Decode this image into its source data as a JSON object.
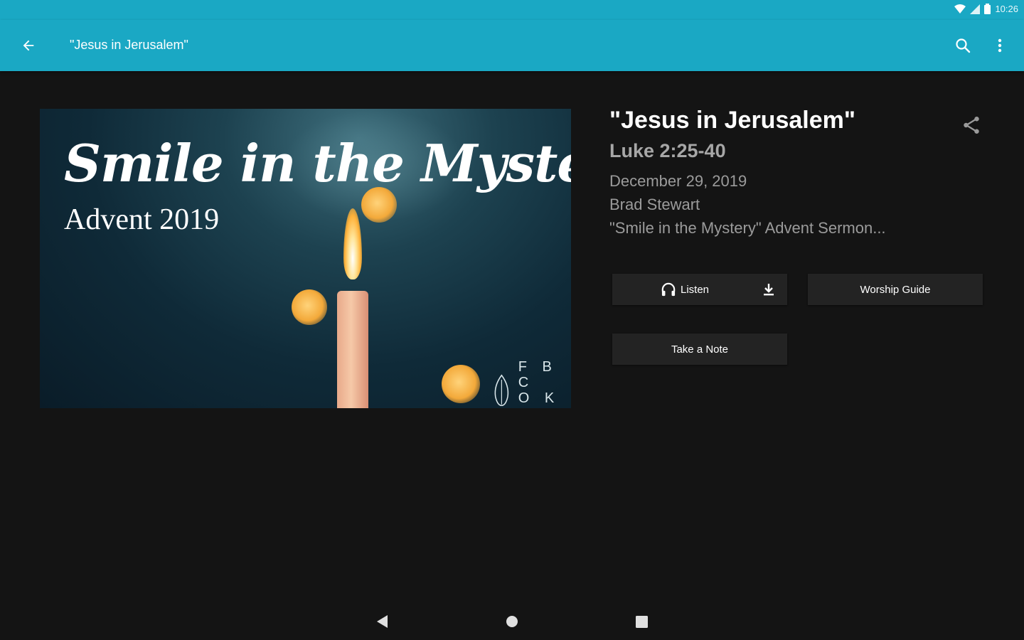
{
  "status_bar": {
    "time": "10:26",
    "icons": [
      "wifi-icon",
      "signal-icon",
      "battery-icon"
    ]
  },
  "app_bar": {
    "title": "\"Jesus in Jerusalem\"",
    "back_icon": "arrow-left-icon",
    "search_icon": "search-icon",
    "menu_icon": "more-vert-icon",
    "color": "#1aa8c4"
  },
  "artwork": {
    "script_title": "Smile in the Mystery",
    "subtitle": "Advent 2019",
    "logo_line1": "F B C",
    "logo_line2": "O K C"
  },
  "sermon": {
    "title": "\"Jesus in Jerusalem\"",
    "scripture": "Luke 2:25-40",
    "date": "December 29, 2019",
    "speaker": "Brad Stewart",
    "series": "\"Smile in the Mystery\" Advent Sermon..."
  },
  "actions": {
    "listen_label": "Listen",
    "worship_guide_label": "Worship Guide",
    "take_note_label": "Take a Note"
  },
  "nav_bar": {
    "icons": [
      "nav-back-icon",
      "nav-home-icon",
      "nav-recents-icon"
    ]
  }
}
